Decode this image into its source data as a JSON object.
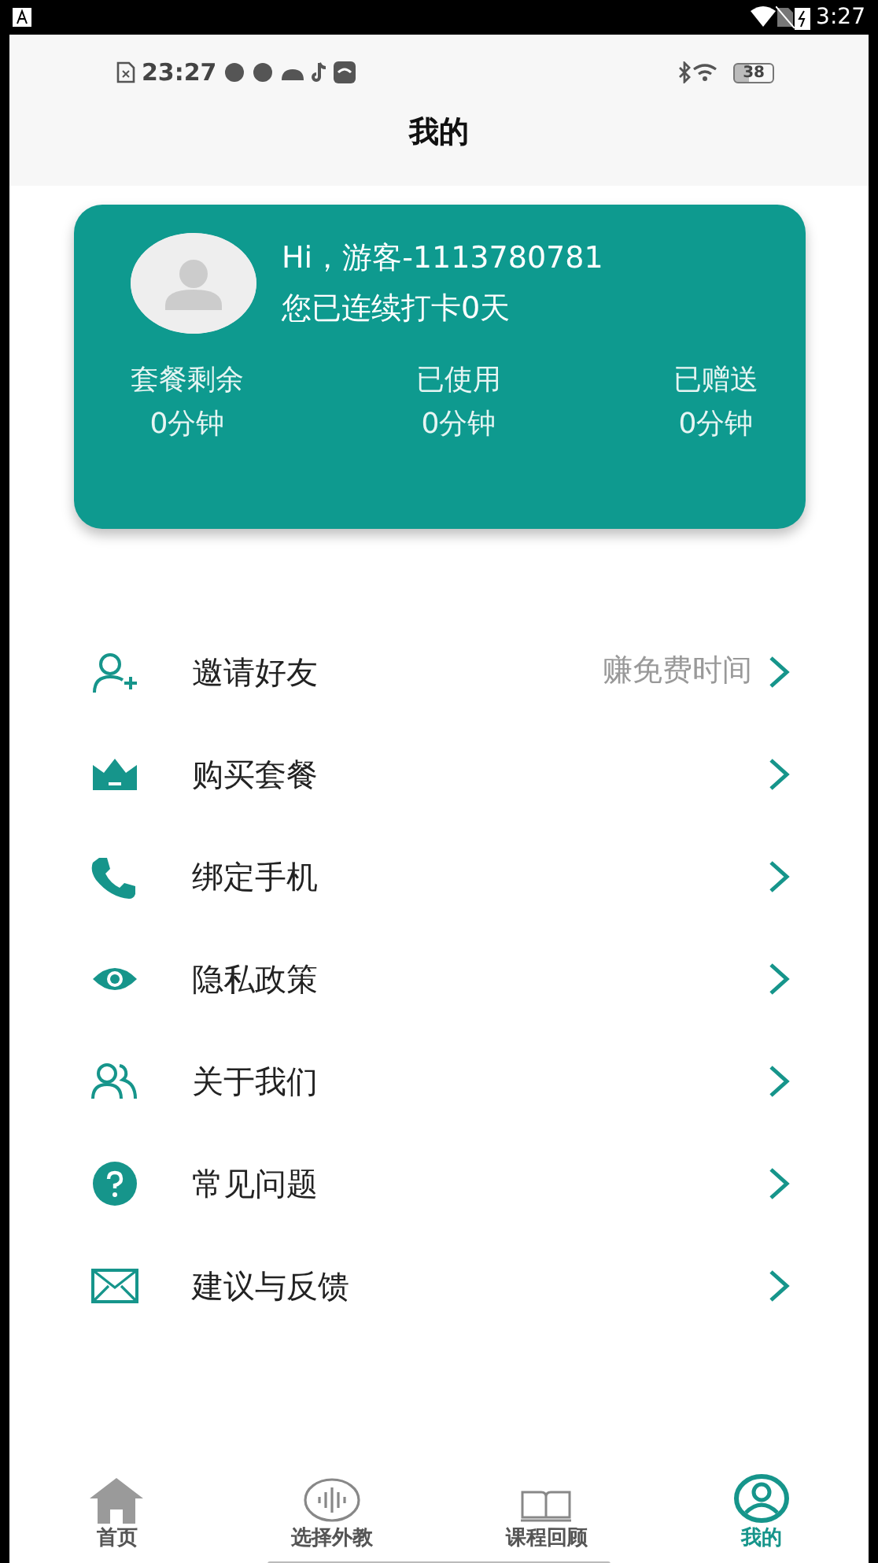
{
  "system_status": {
    "time": "3:27"
  },
  "inner_status": {
    "time": "23:27",
    "battery": "38"
  },
  "header": {
    "title": "我的"
  },
  "profile": {
    "greeting": "Hi，游客-1113780781",
    "checkin": "您已连续打卡0天",
    "stats": [
      {
        "label": "套餐剩余",
        "value": "0分钟"
      },
      {
        "label": "已使用",
        "value": "0分钟"
      },
      {
        "label": "已赠送",
        "value": "0分钟"
      }
    ]
  },
  "menu": [
    {
      "label": "邀请好友",
      "hint": "赚免费时间"
    },
    {
      "label": "购买套餐"
    },
    {
      "label": "绑定手机"
    },
    {
      "label": "隐私政策"
    },
    {
      "label": "关于我们"
    },
    {
      "label": "常见问题"
    },
    {
      "label": "建议与反馈"
    }
  ],
  "tabs": [
    {
      "label": "首页",
      "selected": false
    },
    {
      "label": "选择外教",
      "selected": false
    },
    {
      "label": "课程回顾",
      "selected": false
    },
    {
      "label": "我的",
      "selected": true
    }
  ]
}
